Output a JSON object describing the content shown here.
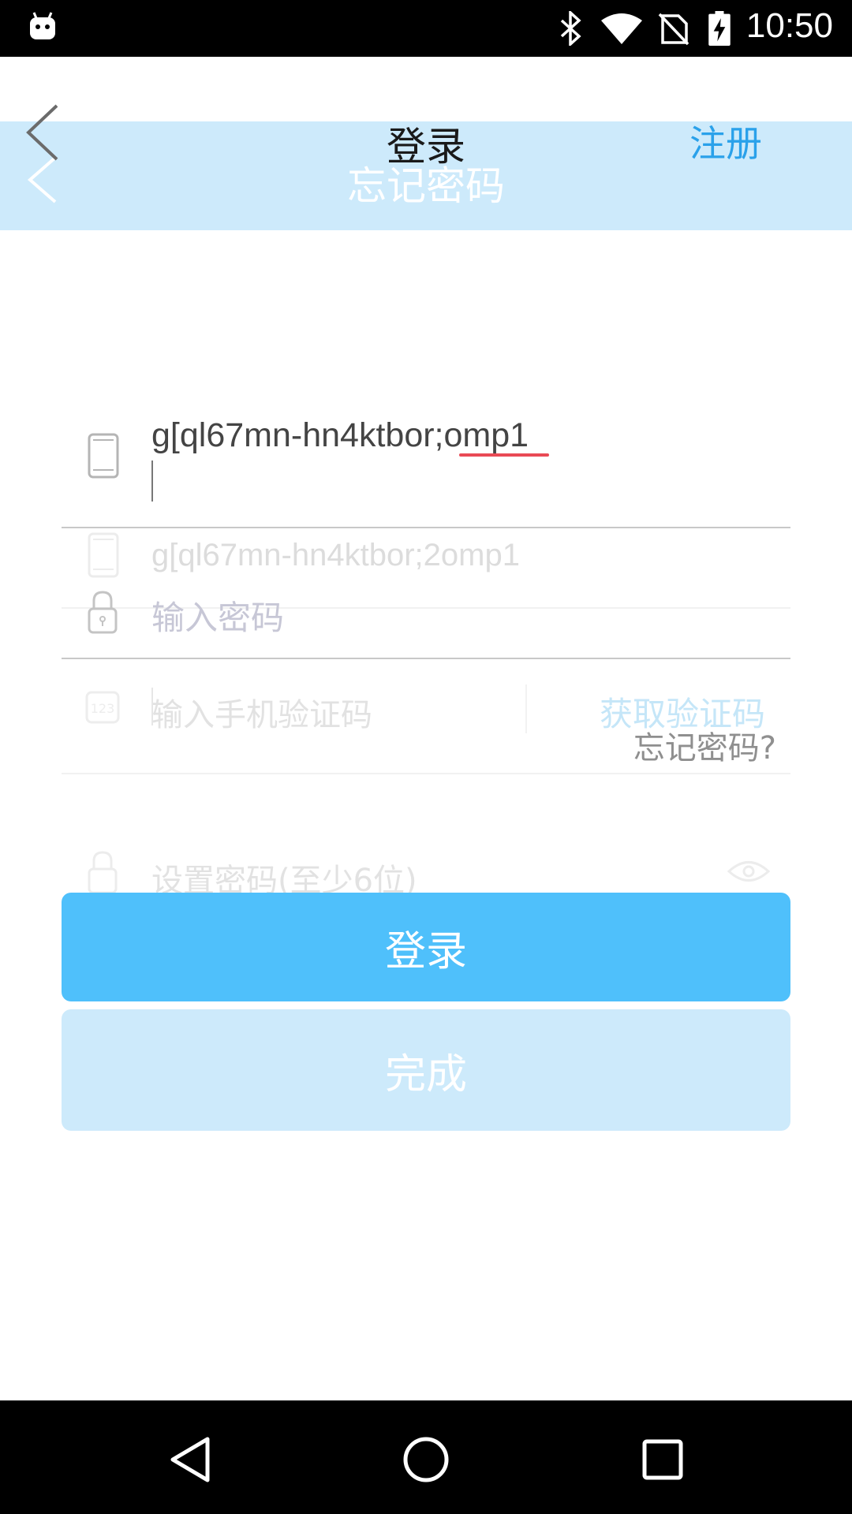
{
  "status_bar": {
    "time": "10:50",
    "icons": [
      "android-notification-icon",
      "bluetooth-icon",
      "wifi-icon",
      "no-sim-icon",
      "battery-charging-icon"
    ]
  },
  "header": {
    "title": "登录",
    "background_title": "忘记密码",
    "register_label": "注册",
    "accent_color": "#2aa1ea",
    "header_bg_color": "#cdeafb"
  },
  "login_form": {
    "phone_value": "g[ql67mn-hn4ktbor;omp1",
    "password_placeholder": "输入密码",
    "forgot_label": "忘记密码?",
    "login_button_label": "登录",
    "button_color": "#4fc0fb"
  },
  "background_form": {
    "phone_value": "g[ql67mn-hn4ktbor;2omp1",
    "code_placeholder": "输入手机验证码",
    "get_code_label": "获取验证码",
    "set_password_placeholder": "设置密码(至少6位)",
    "done_button_label": "完成"
  },
  "nav_bar": {
    "buttons": [
      "back-icon",
      "home-icon",
      "recents-icon"
    ]
  }
}
